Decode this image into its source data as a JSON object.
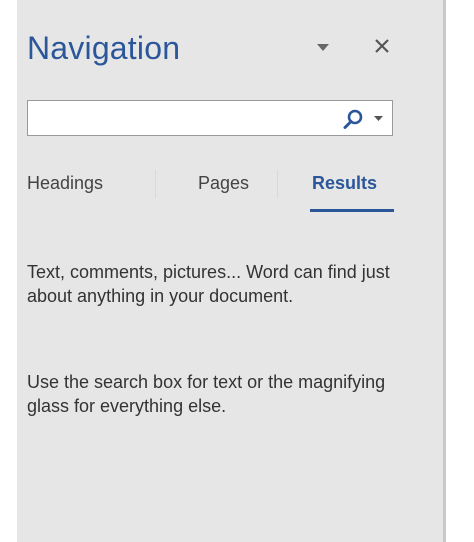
{
  "pane": {
    "title": "Navigation",
    "accent_color": "#2b579a",
    "menu_icon": "chevron-down-icon",
    "close_icon": "close-icon"
  },
  "search": {
    "value": "",
    "placeholder": "",
    "search_icon": "magnifier-icon",
    "dropdown_icon": "caret-down-icon"
  },
  "tabs": [
    {
      "label": "Headings",
      "active": false
    },
    {
      "label": "Pages",
      "active": false
    },
    {
      "label": "Results",
      "active": true
    }
  ],
  "results": {
    "paragraph_1": "Text, comments, pictures... Word can find just about anything in your document.",
    "paragraph_2": "Use the search box for text or the magnifying glass for everything else."
  }
}
